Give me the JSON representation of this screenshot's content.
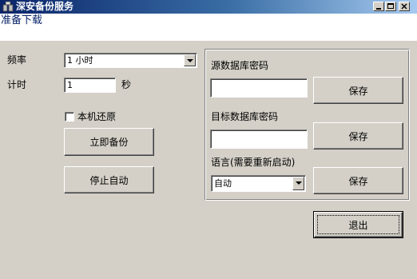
{
  "window": {
    "title": "深安备份服务",
    "status": "准备下载"
  },
  "settings": {
    "frequency_label": "频率",
    "frequency_value": "1 小时",
    "timer_label": "计时",
    "timer_value": "1",
    "timer_unit": "秒",
    "restore_local_label": "本机还原",
    "restore_local_checked": false
  },
  "buttons": {
    "backup_now": "立即备份",
    "stop_auto": "停止自动",
    "save": "保存",
    "exit": "退出"
  },
  "passwords": {
    "source_label": "源数据库密码",
    "source_value": "",
    "target_label": "目标数据库密码",
    "target_value": ""
  },
  "language": {
    "label": "语言(需要重新启动)",
    "value": "自动"
  },
  "icons": {
    "app": "app-icon",
    "minimize": "minimize-icon",
    "maximize": "maximize-icon",
    "close": "close-icon",
    "dropdown": "chevron-down-icon"
  },
  "colors": {
    "title_bar_start": "#0a246a",
    "title_bar_end": "#a6caf0",
    "status_text": "#0a246a",
    "window_bg": "#d4d0c8"
  }
}
